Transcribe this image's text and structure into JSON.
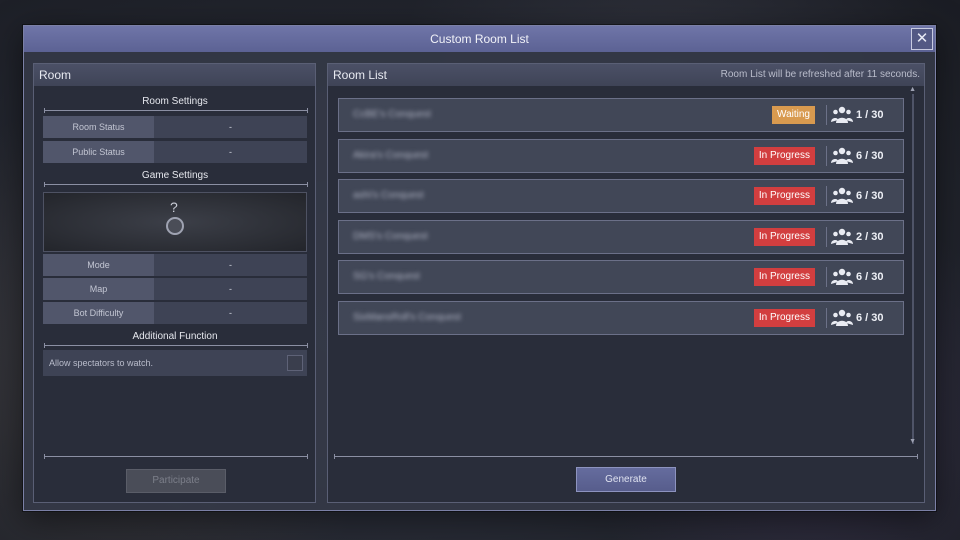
{
  "window": {
    "title": "Custom Room List",
    "close_label": "✕"
  },
  "room_panel": {
    "header": "Room",
    "room_settings_title": "Room Settings",
    "room_status_label": "Room Status",
    "room_status_value": "-",
    "public_status_label": "Public Status",
    "public_status_value": "-",
    "game_settings_title": "Game Settings",
    "map_placeholder": "?",
    "mode_label": "Mode",
    "mode_value": "-",
    "map_label": "Map",
    "map_value": "-",
    "bot_label": "Bot Difficulty",
    "bot_value": "-",
    "additional_title": "Additional Function",
    "spectator_text": "Allow spectators to watch.",
    "participate_label": "Participate"
  },
  "room_list": {
    "header": "Room List",
    "refresh_note": "Room List will be refreshed after 11 seconds.",
    "items": [
      {
        "name": "CcBE's Conquest",
        "status": "Waiting",
        "status_type": "waiting",
        "count": "1 / 30"
      },
      {
        "name": "Akira's Conquest",
        "status": "In Progress",
        "status_type": "progress",
        "count": "6 / 30"
      },
      {
        "name": "ashi's Conquest",
        "status": "In Progress",
        "status_type": "progress",
        "count": "6 / 30"
      },
      {
        "name": "DMS's Conquest",
        "status": "In Progress",
        "status_type": "progress",
        "count": "2 / 30"
      },
      {
        "name": "SG's Conquest",
        "status": "In Progress",
        "status_type": "progress",
        "count": "6 / 30"
      },
      {
        "name": "SixMansRoll's Conquest",
        "status": "In Progress",
        "status_type": "progress",
        "count": "6 / 30"
      }
    ],
    "generate_label": "Generate"
  },
  "colors": {
    "in_progress": "#d23e3f",
    "waiting": "#d89a4f",
    "title_bar": "#6f75a8"
  }
}
